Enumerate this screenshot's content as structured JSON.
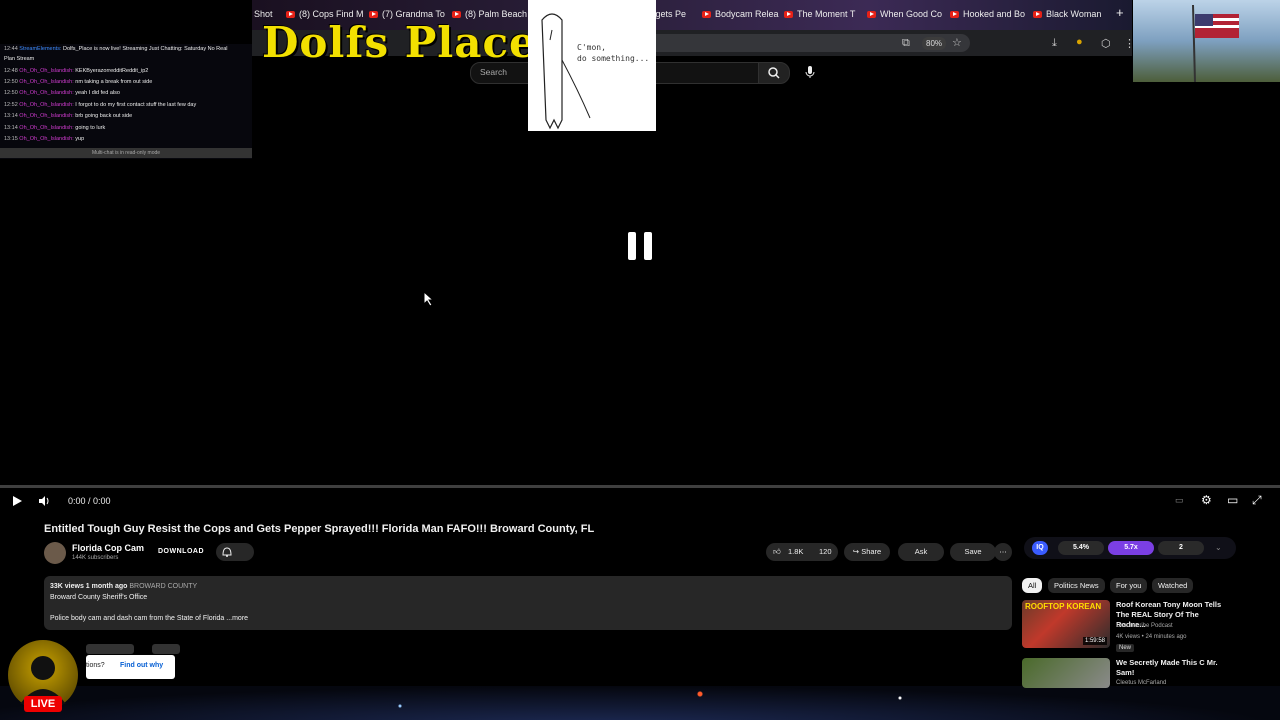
{
  "browser": {
    "tabs": [
      {
        "label": "Shot",
        "youtube": false
      },
      {
        "label": "(8) Cops Find M",
        "youtube": true
      },
      {
        "label": "(7) Grandma To",
        "youtube": true
      },
      {
        "label": "(8) Palm Beach",
        "youtube": true
      },
      {
        "label": "n gets Pe",
        "youtube": false
      },
      {
        "label": "Bodycam Relea",
        "youtube": true
      },
      {
        "label": "The Moment T",
        "youtube": true
      },
      {
        "label": "When Good Co",
        "youtube": true
      },
      {
        "label": "Hooked and Bo",
        "youtube": true
      },
      {
        "label": "Black Woman",
        "youtube": true
      }
    ],
    "new_tab": "+",
    "zoom": "80%"
  },
  "youtube": {
    "search_placeholder": "Search"
  },
  "overlay": {
    "logo_text": "Dolfs Place",
    "meme_text_line1": "C'mon,",
    "meme_text_line2": "do something...",
    "chat": [
      {
        "time": "12:44",
        "user": "StreamElements:",
        "msg": "Dolfs_Place is now live! Streaming Just Chatting: Saturday No Real",
        "user_color": "blue"
      },
      {
        "time": "",
        "user": "",
        "msg": "Plan Stream",
        "user_color": ""
      },
      {
        "time": "12:48",
        "user": "Oh_Oh_Oh_Islandish:",
        "msg": "KEKByerazorredditReddit_ip2",
        "user_color": "pink"
      },
      {
        "time": "12:50",
        "user": "Oh_Oh_Oh_Islandish:",
        "msg": "nm taking a break from out side",
        "user_color": "pink"
      },
      {
        "time": "12:50",
        "user": "Oh_Oh_Oh_Islandish:",
        "msg": "yeah I did fed also",
        "user_color": "pink"
      },
      {
        "time": "12:52",
        "user": "Oh_Oh_Oh_Islandish:",
        "msg": "I forgot to do my first contact stuff the last few day",
        "user_color": "pink"
      },
      {
        "time": "13:14",
        "user": "Oh_Oh_Oh_Islandish:",
        "msg": "brb going back out side",
        "user_color": "pink"
      },
      {
        "time": "13:14",
        "user": "Oh_Oh_Oh_Islandish:",
        "msg": "going to lurk",
        "user_color": "pink"
      },
      {
        "time": "13:15",
        "user": "Oh_Oh_Oh_Islandish:",
        "msg": "yup",
        "user_color": "pink"
      }
    ],
    "chat_footer": "Multi-chat is in read-only mode",
    "live_badge": "LIVE",
    "popup_partial": "tions?",
    "popup_link": "Find out why"
  },
  "player": {
    "time": "0:00 / 0:00"
  },
  "video": {
    "title": "Entitled Tough Guy Resist the Cops and Gets Pepper Sprayed!!! Florida Man FAFO!!! Broward County, FL",
    "channel": "Florida Cop Cam",
    "subscribers": "144K subscribers",
    "download_label": "DOWNLOAD",
    "likes": "1.8K",
    "dislikes": "120",
    "share_label": "Share",
    "ask_label": "Ask",
    "save_label": "Save",
    "views_line": "33K views  1 month ago",
    "location_tag": "BROWARD COUNTY",
    "desc_line1": "Broward County Sheriff's Office",
    "desc_line2": "Police body cam and dash cam from the State of Florida",
    "more_label": "...more"
  },
  "ext_rate": {
    "badge": "IQ",
    "value1": "5.4%",
    "value2": "5.7x",
    "value3": "2"
  },
  "sidebar": {
    "chips": [
      "All",
      "Politics News",
      "For you",
      "Watched"
    ],
    "videos": [
      {
        "title": "Roof Korean Tony Moon Tells The REAL Story Of The Rodne...",
        "channel": "Unsubscribe Podcast",
        "meta": "4K views • 24 minutes ago",
        "badge": "New",
        "duration": "1:59:58",
        "thumb_text": "ROOFTOP KOREAN"
      },
      {
        "title": "We Secretly Made This C Mr. Sam!",
        "channel": "Cleetus McFarland",
        "meta": "",
        "badge": "",
        "duration": "",
        "thumb_text": ""
      }
    ]
  },
  "colors": {
    "yt_red": "#e62117",
    "chat_user_pink": "#d03cd0",
    "chat_user_blue": "#3c8cff",
    "logo_yellow": "#f2e000",
    "rate_purple": "#7b3fe4"
  }
}
